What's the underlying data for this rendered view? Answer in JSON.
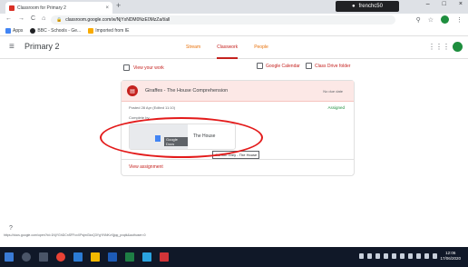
{
  "browser": {
    "tab_title": "Classroom for Primary 2",
    "tab_close": "×",
    "new_tab": "+",
    "profile_name": "frenchc50",
    "window_controls": [
      "–",
      "□",
      "×"
    ],
    "nav": [
      "←",
      "→",
      "C",
      "⌂"
    ],
    "lock": "🔒",
    "url": "classroom.google.com/w/NjYxNDM0NzE0MzZa/t/all",
    "bookmarks": [
      "Apps",
      "BBC - Schools - Ge...",
      "Imported from IE"
    ]
  },
  "classroom": {
    "class_name": "Primary 2",
    "tabs": [
      "Stream",
      "Classwork",
      "People"
    ],
    "active_tab": "Classwork",
    "view_your_work": "View your work",
    "calendar_link": "Google Calendar",
    "drive_link": "Class Drive folder"
  },
  "assignment": {
    "title": "Giraffes - The House Comprehension",
    "due": "No due date",
    "posted": "Posted 28 Apr (Edited 11:10)",
    "status": "Assigned",
    "complete_label": "Complete by...",
    "attachment_type": "Google Docs",
    "attachment_title": "The House",
    "tooltip": "Gordon Grey - The House",
    "view_assignment": "View assignment"
  },
  "status_url": "https://docs.google.com/open?id=1NjYGhDCnSFFcxXPsjmGkxQ3YgYNNKvXjjqq_pxqtk&authuser=0",
  "taskbar": {
    "time": "12:06",
    "date": "17/06/2020"
  },
  "colors": {
    "accent": "#c5221f",
    "assigned": "#1e8e3e",
    "annotation": "#e31b1b"
  }
}
